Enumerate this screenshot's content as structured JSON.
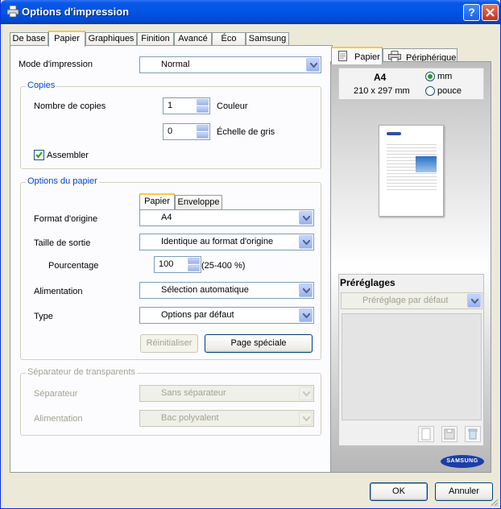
{
  "window": {
    "title": "Options d'impression",
    "help_label": "?"
  },
  "tabs": [
    {
      "label": "De base"
    },
    {
      "label": "Papier"
    },
    {
      "label": "Graphiques"
    },
    {
      "label": "Finition"
    },
    {
      "label": "Avancé"
    },
    {
      "label": "Éco"
    },
    {
      "label": "Samsung"
    }
  ],
  "mode": {
    "label": "Mode d'impression",
    "value": "Normal"
  },
  "copies": {
    "group_label": "Copies",
    "count_label": "Nombre de copies",
    "color_copies": "1",
    "color_label": "Couleur",
    "gray_copies": "0",
    "gray_label": "Échelle de gris",
    "collate_label": "Assembler",
    "collate_checked": true
  },
  "paper": {
    "group_label": "Options du papier",
    "subtabs": [
      {
        "label": "Papier"
      },
      {
        "label": "Enveloppe"
      }
    ],
    "format_label": "Format d'origine",
    "format_value": "A4",
    "output_label": "Taille de sortie",
    "output_value": "Identique au format d'origine",
    "percent_label": "Pourcentage",
    "percent_value": "100",
    "percent_range": "(25-400 %)",
    "source_label": "Alimentation",
    "source_value": "Sélection automatique",
    "type_label": "Type",
    "type_value": "Options par défaut",
    "reset_label": "Réinitialiser",
    "special_label": "Page spéciale"
  },
  "transparency": {
    "group_label": "Séparateur de transparents",
    "separator_label": "Séparateur",
    "separator_value": "Sans séparateur",
    "source_label": "Alimentation",
    "source_value": "Bac polyvalent"
  },
  "preview": {
    "tabs": [
      {
        "label": "Papier"
      },
      {
        "label": "Périphérique"
      }
    ],
    "paper_name": "A4",
    "paper_size": "210 x 297 mm",
    "unit_mm": "mm",
    "unit_inch": "pouce",
    "selected_unit": "mm"
  },
  "presets": {
    "title": "Préréglages",
    "value": "Préréglage par défaut"
  },
  "brand": {
    "logo_text": "SAMSUNG"
  },
  "footer": {
    "ok_label": "OK",
    "cancel_label": "Annuler"
  },
  "colors": {
    "title_bar": "#0055e5",
    "accent_tab": "#ffc83c",
    "group_title": "#0046d5"
  }
}
